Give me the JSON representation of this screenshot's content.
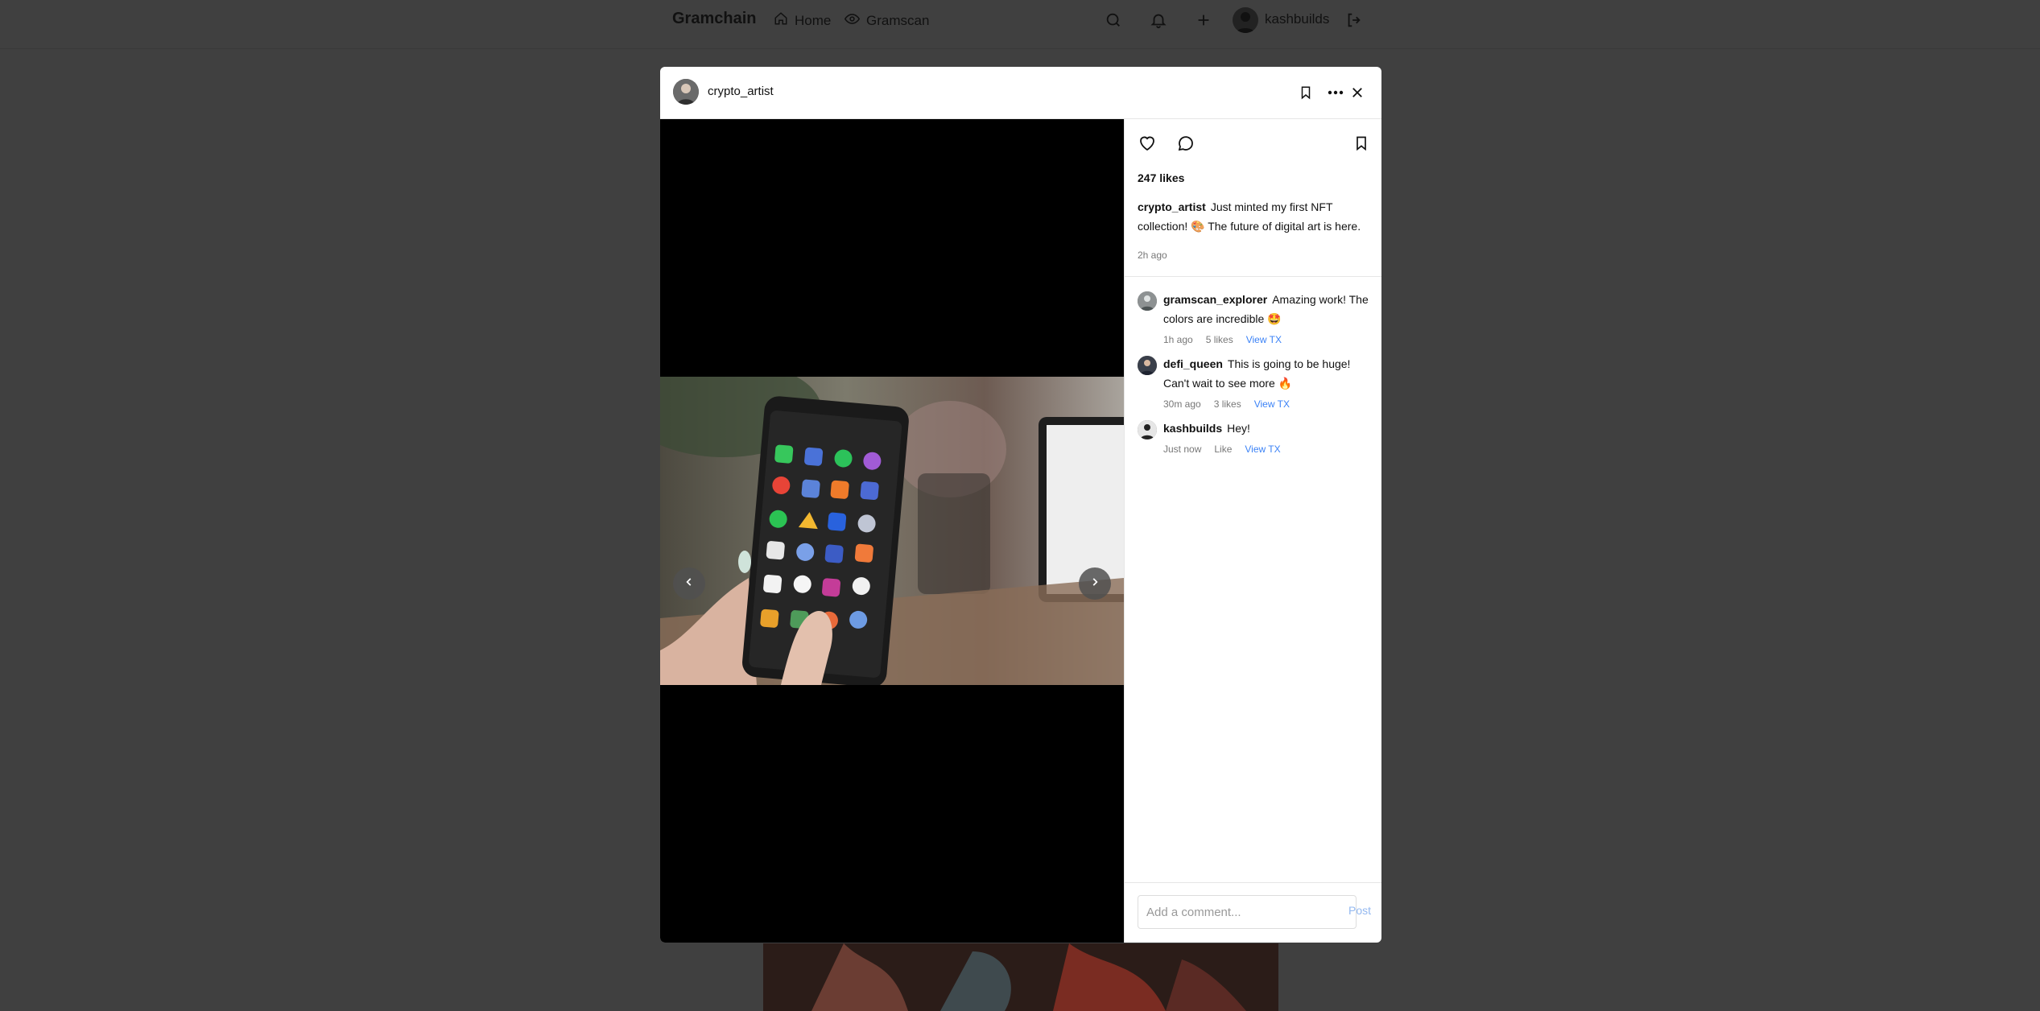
{
  "nav": {
    "brand": "Gramchain",
    "home_label": "Home",
    "gramscan_label": "Gramscan",
    "username": "kashbuilds",
    "icons": [
      "home-icon",
      "eye-icon",
      "search-icon",
      "bell-icon",
      "plus-icon",
      "avatar",
      "logout-icon"
    ]
  },
  "modal": {
    "author": "crypto_artist",
    "header_icons": [
      "bookmark-icon",
      "more-icon",
      "close-icon"
    ],
    "media": {
      "slide_count": 3,
      "active_slide": 1
    },
    "likes": "247 likes",
    "caption_user": "crypto_artist",
    "caption_text": "Just minted my first NFT collection! 🎨 The future of digital art is here.",
    "post_time": "2h ago",
    "comments": [
      {
        "user": "gramscan_explorer",
        "text": "Amazing work! The colors are incredible 🤩",
        "time": "1h ago",
        "likes": "5 likes",
        "tx": "View TX"
      },
      {
        "user": "defi_queen",
        "text": "This is going to be huge! Can't wait to see more 🔥",
        "time": "30m ago",
        "likes": "3 likes",
        "tx": "View TX"
      },
      {
        "user": "kashbuilds",
        "text": "Hey!",
        "time": "Just now",
        "likes": "Like",
        "tx": "View TX"
      }
    ],
    "comment_placeholder": "Add a comment...",
    "post_label": "Post"
  },
  "colors": {
    "overlay": "#404040",
    "link": "#3b82f6",
    "post_disabled": "#93b8f0"
  }
}
